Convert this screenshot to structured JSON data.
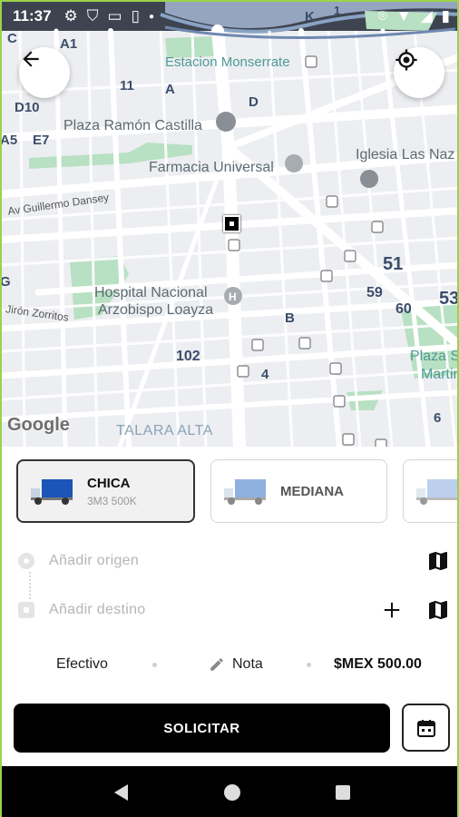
{
  "status_bar": {
    "time": "11:37",
    "left_icons": [
      "gear-icon",
      "shield-icon",
      "cast-icon",
      "sim-icon",
      "dot-icon"
    ],
    "right_icons": [
      "location-icon",
      "wifi-icon",
      "signal-icon",
      "battery-icon"
    ]
  },
  "map": {
    "labels": {
      "estacion": "Estacion Monserrate",
      "plaza_castilla": "Plaza Ramón Castilla",
      "farmacia": "Farmacia Universal",
      "iglesia": "Iglesia Las Naz",
      "hospital_1": "Hospital Nacional",
      "hospital_2": "Arzobispo Loayza",
      "talara": "TALARA ALTA",
      "plaza_s": "Plaza S",
      "martin": "Martin",
      "guillermo": "Av Guillermo Dansey",
      "zorritos": "Jirón Zorritos"
    },
    "block_codes": [
      "C",
      "A1",
      "11",
      "A",
      "D",
      "D10",
      "E7",
      "A5",
      "B",
      "51",
      "59",
      "60",
      "53",
      "102",
      "4",
      "6",
      "G",
      "K",
      "1"
    ],
    "attribution": "Google"
  },
  "vehicles": [
    {
      "name": "CHICA",
      "subtitle": "3M3 500K",
      "selected": true
    },
    {
      "name": "MEDIANA",
      "subtitle": "",
      "selected": false
    },
    {
      "name": "",
      "subtitle": "",
      "selected": false
    }
  ],
  "origin": {
    "placeholder": "Añadir origen"
  },
  "destination": {
    "placeholder": "Añadir destino"
  },
  "payment": {
    "method": "Efectivo",
    "note_label": "Nota",
    "price": "$MEX 500.00"
  },
  "actions": {
    "request_label": "SOLICITAR"
  },
  "colors": {
    "accent": "#000000",
    "frame": "#9bd34a",
    "park": "#b8e0c2",
    "water": "#9fb0cc"
  }
}
